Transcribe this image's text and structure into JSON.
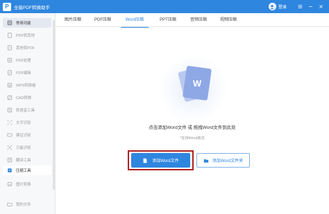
{
  "app": {
    "title": "全能PDF转换助手",
    "logo_letter": "P"
  },
  "titlebar": {
    "login_label": "登录"
  },
  "sidebar": {
    "items": [
      {
        "label": "常用功能",
        "icon": "home-icon"
      },
      {
        "label": "PDF转其他",
        "icon": "pdf-convert-icon"
      },
      {
        "label": "其他转PDF",
        "icon": "to-pdf-icon"
      },
      {
        "label": "PDF处理",
        "icon": "pdf-process-icon"
      },
      {
        "label": "PDF编辑",
        "icon": "pdf-edit-icon"
      },
      {
        "label": "WPS转换格",
        "icon": "wps-icon"
      },
      {
        "label": "CAD转换",
        "icon": "cad-icon"
      },
      {
        "label": "转语音工具",
        "icon": "voice-icon"
      },
      {
        "label": "文字识别",
        "icon": "ocr-icon"
      },
      {
        "label": "票证识别",
        "icon": "ticket-icon"
      },
      {
        "label": "万能识别",
        "icon": "scan-icon"
      },
      {
        "label": "翻译工具",
        "icon": "translate-icon"
      },
      {
        "label": "压缩工具",
        "icon": "compress-icon"
      },
      {
        "label": "图片转换",
        "icon": "image-convert-icon"
      },
      {
        "label": "我的文件",
        "icon": "folder-icon"
      }
    ]
  },
  "tabs": [
    {
      "label": "图片压缩"
    },
    {
      "label": "PDF压缩"
    },
    {
      "label": "Word压缩"
    },
    {
      "label": "PPT压缩"
    },
    {
      "label": "音频压缩"
    },
    {
      "label": "视频压缩"
    }
  ],
  "main": {
    "doc_letter": "W",
    "drop_text": "点击添加Word文件 或 拖拽Word文件到此处",
    "hint_text": "*支持Word格式",
    "add_file_label": "添加Word文件",
    "add_folder_label": "添加Word文件夹"
  },
  "colors": {
    "accent": "#2f86df",
    "highlight_border": "#b01e1e",
    "sidebar_bg": "#f7f8fa"
  }
}
